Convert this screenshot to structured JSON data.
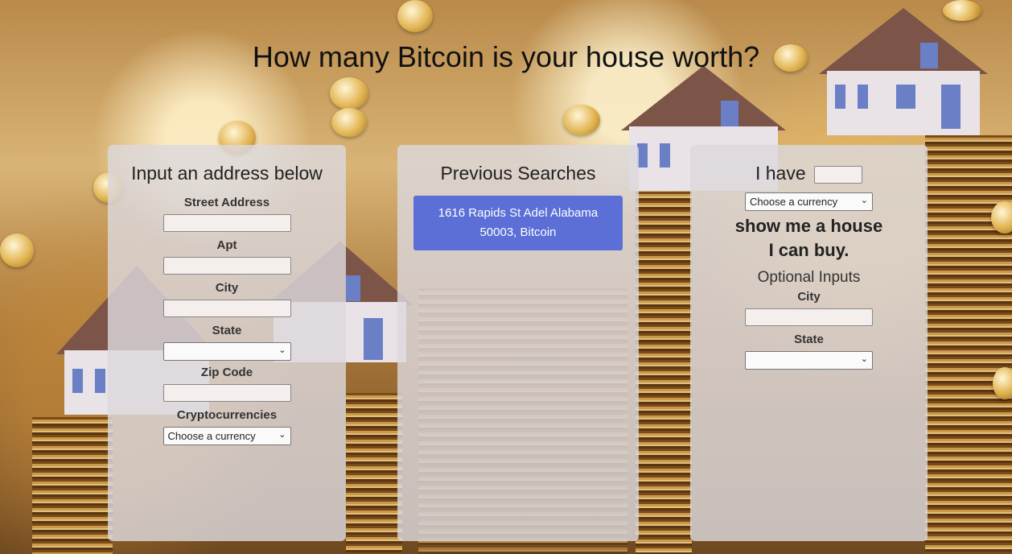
{
  "page": {
    "title": "How many Bitcoin is your house worth?"
  },
  "address_panel": {
    "heading": "Input an address below",
    "street_label": "Street Address",
    "street_value": "",
    "apt_label": "Apt",
    "apt_value": "",
    "city_label": "City",
    "city_value": "",
    "state_label": "State",
    "state_value": "",
    "zip_label": "Zip Code",
    "zip_value": "",
    "crypto_label": "Cryptocurrencies",
    "crypto_value": "Choose a currency"
  },
  "history_panel": {
    "heading": "Previous Searches",
    "results": [
      {
        "line1": "1616 Rapids St Adel Alabama",
        "line2": "50003, Bitcoin"
      }
    ]
  },
  "reverse_panel": {
    "i_have": "I have",
    "amount_value": "",
    "currency_value": "Choose a currency",
    "show_line1": "show me a house",
    "show_line2": "I can buy.",
    "optional_heading": "Optional Inputs",
    "city_label": "City",
    "city_value": "",
    "state_label": "State",
    "state_value": ""
  },
  "icons": {
    "select_chevron": "chevron-down-icon"
  }
}
